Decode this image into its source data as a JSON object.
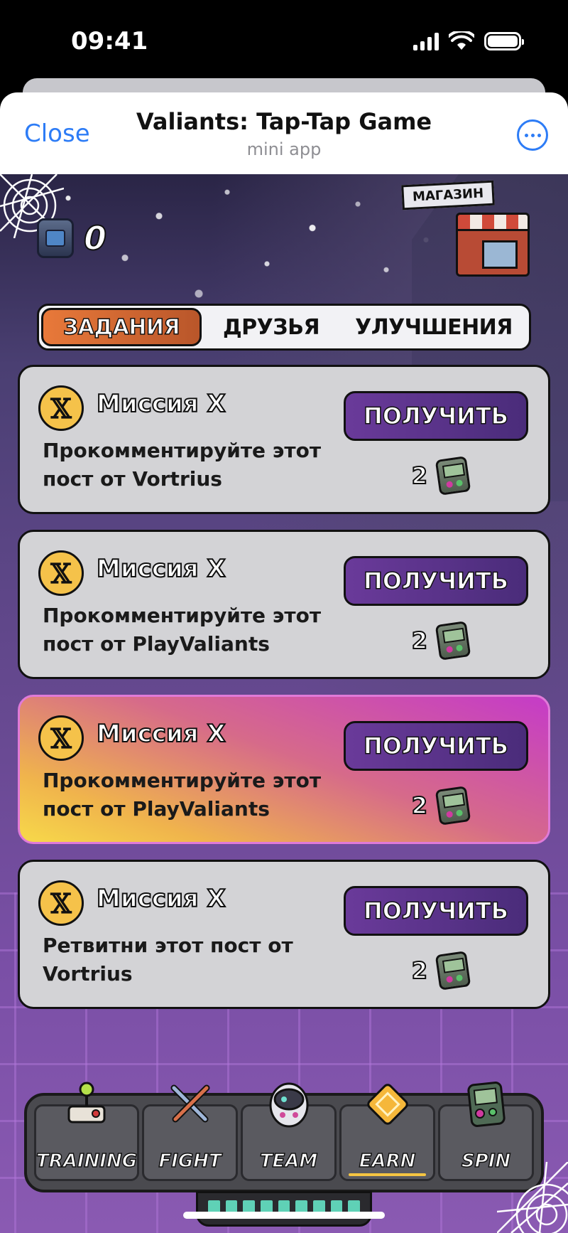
{
  "status_bar": {
    "time": "09:41"
  },
  "header": {
    "close_label": "Close",
    "title": "Valiants: Tap-Tap Game",
    "subtitle": "mini app"
  },
  "hud": {
    "currency_value": "0",
    "shop_label": "МАГАЗИН"
  },
  "tabs": [
    {
      "label": "ЗАДАНИЯ",
      "active": true
    },
    {
      "label": "ДРУЗЬЯ",
      "active": false
    },
    {
      "label": "УЛУЧШЕНИЯ",
      "active": false
    }
  ],
  "missions": [
    {
      "icon": "𝕏",
      "name": "Миссия X",
      "description": "Прокомментируйте этот пост от Vortrius",
      "button_label": "ПОЛУЧИТЬ",
      "reward": "2",
      "featured": false
    },
    {
      "icon": "𝕏",
      "name": "Миссия X",
      "description": "Прокомментируйте этот пост от PlayValiants",
      "button_label": "ПОЛУЧИТЬ",
      "reward": "2",
      "featured": false
    },
    {
      "icon": "𝕏",
      "name": "Миссия X",
      "description": "Прокомментируйте этот пост от PlayValiants",
      "button_label": "ПОЛУЧИТЬ",
      "reward": "2",
      "featured": true
    },
    {
      "icon": "𝕏",
      "name": "Миссия X",
      "description": "Ретвитни этот пост от Vortrius",
      "button_label": "ПОЛУЧИТЬ",
      "reward": "2",
      "featured": false
    }
  ],
  "nav": [
    {
      "label": "TRAINING",
      "icon": "joystick-icon",
      "active": false
    },
    {
      "label": "FIGHT",
      "icon": "crossed-swords-icon",
      "active": false
    },
    {
      "label": "TEAM",
      "icon": "robot-head-icon",
      "active": false
    },
    {
      "label": "EARN",
      "icon": "diamond-coin-icon",
      "active": true
    },
    {
      "label": "SPIN",
      "icon": "handheld-console-icon",
      "active": false
    }
  ],
  "colors": {
    "accent_link": "#2d7cf6",
    "active_tab": "#e8793a",
    "claim_button": "#5a3490",
    "nav_active_underline": "#f5c542"
  }
}
